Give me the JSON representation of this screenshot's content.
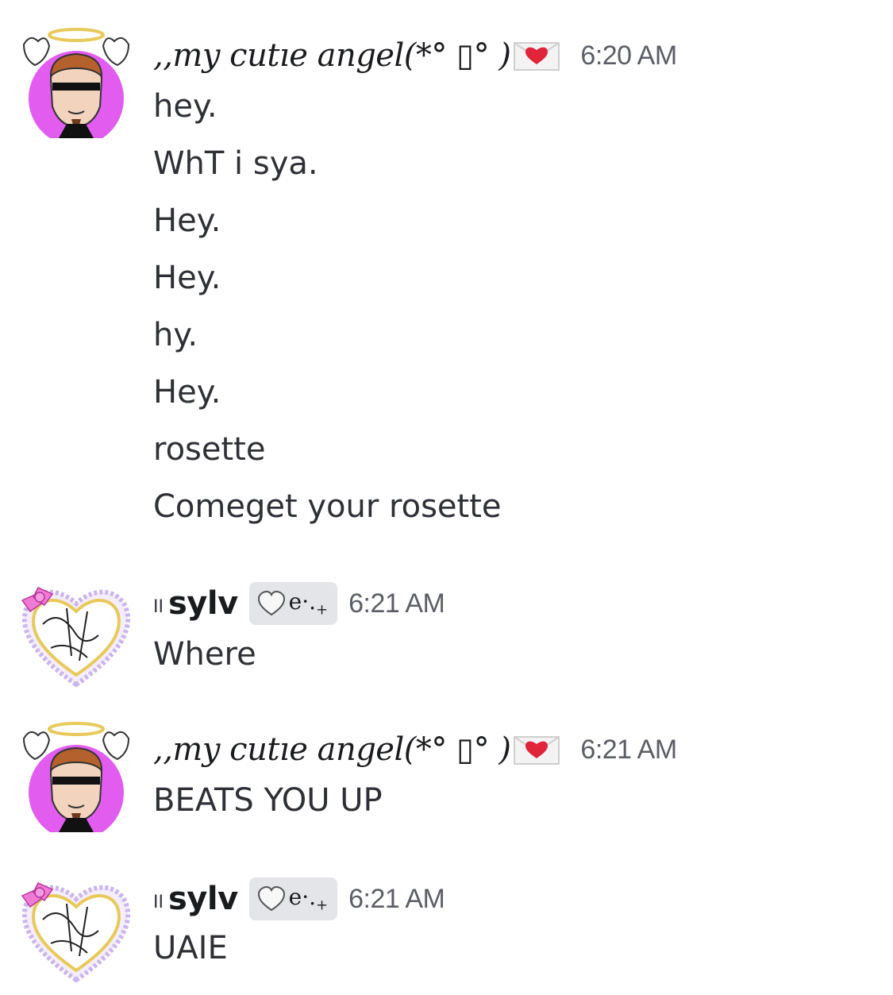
{
  "messages": [
    {
      "author": ",,my cutıe angel(*° ▯° )",
      "author_icon": "love-letter-envelope",
      "time": "6:20 AM",
      "avatar": "angel-avatar",
      "lines": [
        "hey.",
        "WhT i sya.",
        "Hey.",
        "Hey.",
        "hy.",
        "Hey.",
        "rosette",
        "Comeget your rosette"
      ]
    },
    {
      "author_prefix": "II",
      "author": "sylv",
      "tag": "e·.",
      "tag_plus": "+",
      "tag_icon": "white-heart",
      "time": "6:21 AM",
      "avatar": "heart-frame-avatar",
      "lines": [
        "Where"
      ]
    },
    {
      "author": ",,my cutıe angel(*° ▯° )",
      "author_icon": "love-letter-envelope",
      "time": "6:21 AM",
      "avatar": "angel-avatar",
      "lines": [
        "BEATS YOU UP"
      ]
    },
    {
      "author_prefix": "II",
      "author": "sylv",
      "tag": "e·.",
      "tag_plus": "+",
      "tag_icon": "white-heart",
      "time": "6:21 AM",
      "avatar": "heart-frame-avatar",
      "lines": [
        "UAIE"
      ]
    }
  ],
  "colors": {
    "background": "#ffffff",
    "text": "#2e3035",
    "timestamp": "#5c5e66",
    "tag_chip": "#e3e5e8",
    "avatar_purple": "#e25cf0",
    "heart_gold": "#e8c95a",
    "envelope_heart": "#e0243a"
  }
}
